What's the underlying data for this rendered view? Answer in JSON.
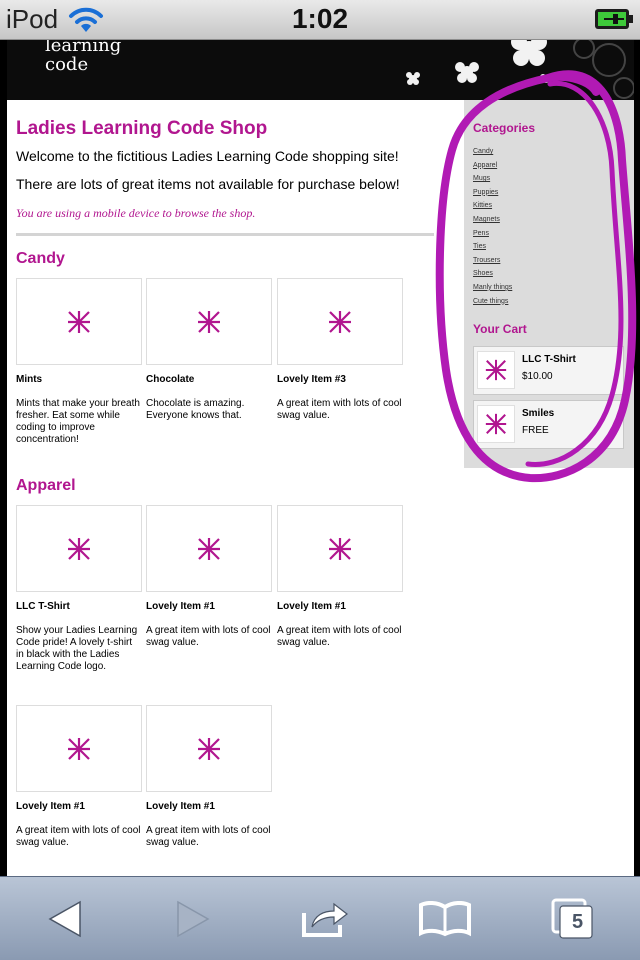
{
  "status_bar": {
    "device": "iPod",
    "time": "1:02"
  },
  "header": {
    "logo_line1": "learning",
    "logo_line2": "code"
  },
  "main": {
    "title": "Ladies Learning Code Shop",
    "welcome": "Welcome to the fictitious Ladies Learning Code shopping site!",
    "items_note": "There are lots of great items not available for purchase below!",
    "mobile_note": "You are using a mobile device to browse the shop."
  },
  "categories": [
    {
      "title": "Candy",
      "products": [
        {
          "name": "Mints",
          "desc": "Mints that make your breath fresher. Eat some while coding to improve concentration!"
        },
        {
          "name": "Chocolate",
          "desc": "Chocolate is amazing. Everyone knows that."
        },
        {
          "name": "Lovely Item #3",
          "desc": "A great item with lots of cool swag value."
        }
      ]
    },
    {
      "title": "Apparel",
      "products": [
        {
          "name": "LLC T-Shirt",
          "desc": "Show your Ladies Learning Code pride! A lovely t-shirt in black with the Ladies Learning Code logo."
        },
        {
          "name": "Lovely Item #1",
          "desc": "A great item with lots of cool swag value."
        },
        {
          "name": "Lovely Item #1",
          "desc": "A great item with lots of cool swag value."
        },
        {
          "name": "Lovely Item #1",
          "desc": "A great item with lots of cool swag value."
        },
        {
          "name": "Lovely Item #1",
          "desc": "A great item with lots of cool swag value."
        }
      ]
    }
  ],
  "sidebar": {
    "categories_title": "Categories",
    "categories": [
      "Candy",
      "Apparel",
      "Mugs",
      "Puppies",
      "Kitties",
      "Magnets",
      "Pens",
      "Ties",
      "Trousers",
      "Shoes",
      "Manly things",
      "Cute things"
    ],
    "cart_title": "Your Cart",
    "cart": [
      {
        "name": "LLC T-Shirt",
        "price": "$10.00"
      },
      {
        "name": "Smiles",
        "price": "FREE"
      }
    ]
  },
  "toolbar": {
    "tabs_count": "5"
  },
  "colors": {
    "accent": "#b1168f",
    "annotation": "#b11ab4",
    "header_bg": "#0c0c0c",
    "sidebar_bg": "#dcdcdc"
  },
  "icons": [
    "wifi-icon",
    "battery-icon",
    "back-icon",
    "forward-icon",
    "share-icon",
    "bookmarks-icon",
    "tabs-icon",
    "product-placeholder-icon",
    "flower-icon"
  ]
}
